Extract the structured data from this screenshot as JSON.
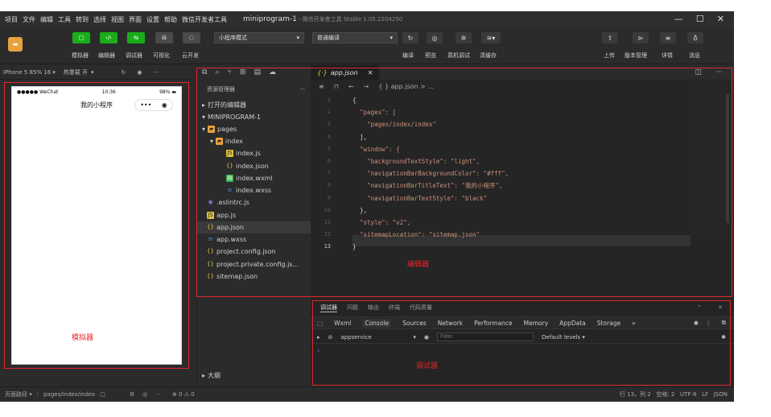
{
  "menubar": {
    "items": [
      "项目",
      "文件",
      "编辑",
      "工具",
      "转到",
      "选择",
      "视图",
      "界面",
      "设置",
      "帮助",
      "微信开发者工具"
    ],
    "title": "miniprogram-1",
    "subtitle": "- 微信开发者工具 Stable 1.05.2204250"
  },
  "toolbar": {
    "buttons": [
      {
        "name": "simulator",
        "label": "模拟器"
      },
      {
        "name": "editor",
        "label": "编辑器"
      },
      {
        "name": "debugger",
        "label": "调试器"
      },
      {
        "name": "visual",
        "label": "可视化"
      },
      {
        "name": "cloud",
        "label": "云开发"
      }
    ],
    "mode_select": "小程序模式",
    "compile_select": "普通编译",
    "right_actions": [
      "编译",
      "预览",
      "真机调试",
      "清缓存"
    ],
    "far_right": [
      "上传",
      "版本管理",
      "详情",
      "消息"
    ]
  },
  "simulator": {
    "device": "iPhone 5 85% 16",
    "hotreload": "热重载 开",
    "status_left": "●●●●● WeChat",
    "status_time": "10:36",
    "status_battery": "98%",
    "nav_title": "我的小程序",
    "label": "模拟器"
  },
  "tree": {
    "header": "资源管理器",
    "sections": [
      "打开的编辑器",
      "MINIPROGRAM-1"
    ],
    "items": [
      {
        "label": "pages",
        "depth": 1,
        "type": "folder"
      },
      {
        "label": "index",
        "depth": 2,
        "type": "folder"
      },
      {
        "label": "index.js",
        "depth": 3,
        "type": "js"
      },
      {
        "label": "index.json",
        "depth": 3,
        "type": "json"
      },
      {
        "label": "index.wxml",
        "depth": 3,
        "type": "wxml"
      },
      {
        "label": "index.wxss",
        "depth": 3,
        "type": "wxss"
      },
      {
        "label": ".eslintrc.js",
        "depth": 1,
        "type": "eslint"
      },
      {
        "label": "app.js",
        "depth": 1,
        "type": "js"
      },
      {
        "label": "app.json",
        "depth": 1,
        "type": "json"
      },
      {
        "label": "app.wxss",
        "depth": 1,
        "type": "wxss"
      },
      {
        "label": "project.config.json",
        "depth": 1,
        "type": "json"
      },
      {
        "label": "project.private.config.js...",
        "depth": 1,
        "type": "json"
      },
      {
        "label": "sitemap.json",
        "depth": 1,
        "type": "json"
      }
    ],
    "outline": "大纲"
  },
  "editor": {
    "tab": "app.json",
    "breadcrumb": "{ } app.json > ...",
    "label": "编辑器",
    "lines": [
      "{",
      "  \"pages\": [",
      "    \"pages/index/index\"",
      "  ],",
      "  \"window\": {",
      "    \"backgroundTextStyle\": \"light\",",
      "    \"navigationBarBackgroundColor\": \"#fff\",",
      "    \"navigationBarTitleText\": \"我的小程序\",",
      "    \"navigationBarTextStyle\": \"black\"",
      "  },",
      "  \"style\": \"v2\",",
      "  \"sitemapLocation\": \"sitemap.json\"",
      "}"
    ]
  },
  "debug": {
    "top_tabs": [
      "调试器",
      "问题",
      "输出",
      "终端",
      "代码质量"
    ],
    "tabs": [
      "Wxml",
      "Console",
      "Sources",
      "Network",
      "Performance",
      "Memory",
      "AppData",
      "Storage"
    ],
    "context": "appservice",
    "filter_placeholder": "Filter",
    "levels": "Default levels ▾",
    "label": "调试器"
  },
  "statusbar": {
    "left": "页面路径 ▾",
    "path": "pages/index/index",
    "problems": "⊗ 0 ⚠ 0",
    "right": "行 13，列 2   空格: 2   UTF-8   LF   JSON"
  }
}
